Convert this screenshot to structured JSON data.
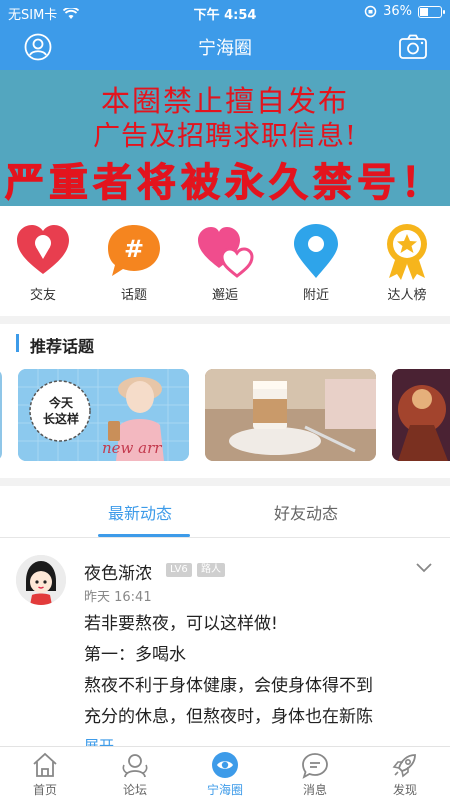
{
  "status_bar": {
    "carrier": "无SIM卡",
    "time": "下午 4:54",
    "battery": "36%",
    "battery_level": 0.36
  },
  "header": {
    "title": "宁海圈",
    "left_icon": "user-icon",
    "right_icon": "camera-icon"
  },
  "banner": {
    "line1": "本圈禁止擅自发布",
    "line2": "广告及招聘求职信息!",
    "line3": "严重者将被永久禁号！"
  },
  "quick_nav": [
    {
      "label": "交友",
      "icon": "heart-pin-icon",
      "color": "#e83e4f"
    },
    {
      "label": "话题",
      "icon": "hashtag-bubble-icon",
      "color": "#f5851f"
    },
    {
      "label": "邂逅",
      "icon": "double-heart-icon",
      "color": "#f04d8d"
    },
    {
      "label": "附近",
      "icon": "location-pin-icon",
      "color": "#2ea4ea"
    },
    {
      "label": "达人榜",
      "icon": "medal-star-icon",
      "color": "#f6b51c"
    }
  ],
  "topics": {
    "title": "推荐话题",
    "card1_badge": "今天\n长这样",
    "card1_caption": "new arr"
  },
  "tabs": [
    {
      "label": "最新动态",
      "active": true
    },
    {
      "label": "好友动态",
      "active": false
    }
  ],
  "post": {
    "author": "夜色渐浓",
    "level": "LV6",
    "role": "路人",
    "time": "昨天 16:41",
    "lines": [
      "若非要熬夜，可以这样做!",
      "第一：多喝水",
      "熬夜不利于身体健康，会使身体得不到",
      "充分的休息，但熬夜时，身体也在新陈"
    ],
    "more": "展开"
  },
  "bottom_nav": [
    {
      "label": "首页",
      "icon": "home-icon",
      "active": false
    },
    {
      "label": "论坛",
      "icon": "forum-icon",
      "active": false
    },
    {
      "label": "宁海圈",
      "icon": "circle-eye-icon",
      "active": true
    },
    {
      "label": "消息",
      "icon": "message-icon",
      "active": false
    },
    {
      "label": "发现",
      "icon": "rocket-icon",
      "active": false
    }
  ],
  "colors": {
    "primary": "#3d9be9",
    "banner_bg": "#53a6bf",
    "banner_text": "#e3141e"
  }
}
